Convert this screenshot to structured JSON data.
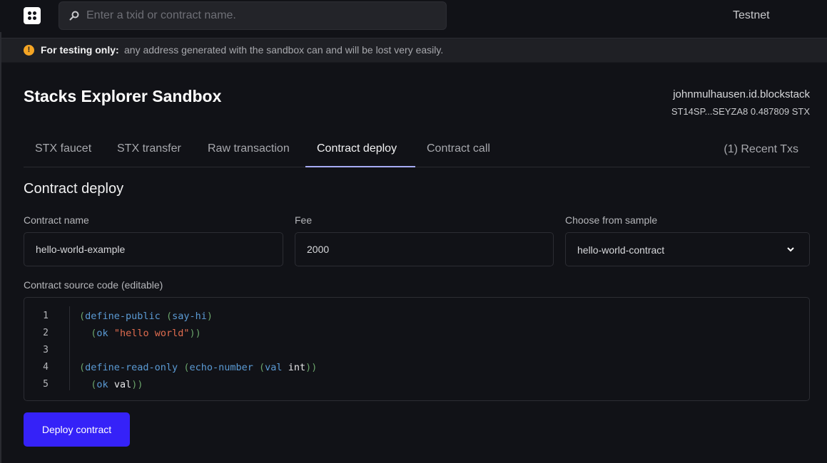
{
  "header": {
    "logo_icon": "stacks-logo-icon",
    "search": {
      "placeholder": "Enter a txid or contract name.",
      "value": ""
    },
    "network": "Testnet"
  },
  "banner": {
    "icon": "warning-icon",
    "strong": "For testing only:",
    "text": "any address generated with the sandbox can and will be lost very easily."
  },
  "page": {
    "title": "Stacks Explorer Sandbox",
    "user": {
      "name": "johnmulhausen.id.blockstack",
      "address_balance": "ST14SP...SEYZA8 0.487809 STX"
    }
  },
  "tabs": [
    {
      "label": "STX faucet",
      "active": false
    },
    {
      "label": "STX transfer",
      "active": false
    },
    {
      "label": "Raw transaction",
      "active": false
    },
    {
      "label": "Contract deploy",
      "active": true
    },
    {
      "label": "Contract call",
      "active": false
    }
  ],
  "recent_txs": "(1) Recent Txs",
  "form": {
    "section_title": "Contract deploy",
    "contract_name": {
      "label": "Contract name",
      "value": "hello-world-example"
    },
    "fee": {
      "label": "Fee",
      "value": "2000"
    },
    "sample": {
      "label": "Choose from sample",
      "value": "hello-world-contract"
    },
    "code_label": "Contract source code (editable)",
    "line_numbers": [
      "1",
      "2",
      "3",
      "4",
      "5"
    ],
    "code_lines": [
      "(define-public (say-hi)",
      "  (ok \"hello world\"))",
      "",
      "(define-read-only (echo-number (val int))",
      "  (ok val))"
    ],
    "submit_label": "Deploy contract"
  },
  "colors": {
    "accent": "#3522f8",
    "tab_indicator": "#a8adf6",
    "warning": "#f5a524",
    "background": "#111217"
  }
}
